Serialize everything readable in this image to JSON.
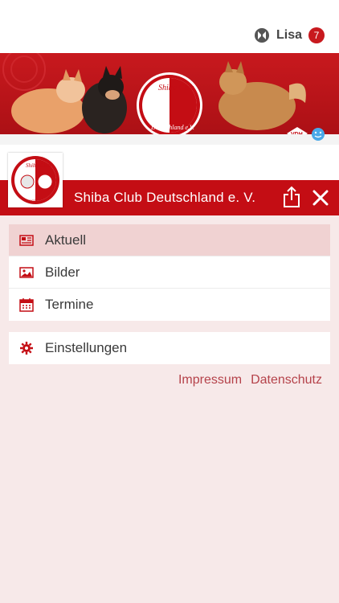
{
  "user": {
    "name": "Lisa",
    "notification_count": "7"
  },
  "banner": {
    "logo_top_text": "Shiba Club",
    "logo_bottom_text": "Deutschland e.V.",
    "logo_small": "SCD",
    "vdh_label": "VDH"
  },
  "header": {
    "title": "Shiba Club Deutschland e. V."
  },
  "menu": {
    "main": [
      {
        "label": "Aktuell",
        "icon": "newspaper-icon"
      },
      {
        "label": "Bilder",
        "icon": "image-icon"
      },
      {
        "label": "Termine",
        "icon": "calendar-icon"
      }
    ],
    "settings": {
      "label": "Einstellungen",
      "icon": "gear-icon"
    }
  },
  "footer": {
    "impressum": "Impressum",
    "datenschutz": "Datenschutz"
  },
  "colors": {
    "brand_red": "#c40d14",
    "active_bg": "#f0d2d2",
    "page_bg": "#f7e9e9",
    "link": "#b5424a"
  }
}
